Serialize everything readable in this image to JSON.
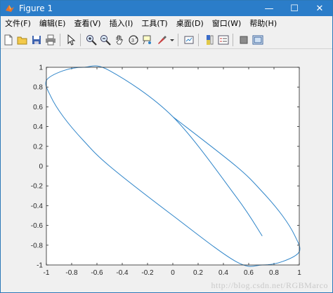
{
  "window": {
    "title": "Figure 1"
  },
  "menu": [
    "文件(F)",
    "编辑(E)",
    "查看(V)",
    "插入(I)",
    "工具(T)",
    "桌面(D)",
    "窗口(W)",
    "帮助(H)"
  ],
  "toolbar": {
    "icons": [
      "new-figure-icon",
      "open-file-icon",
      "save-icon",
      "print-icon",
      "pointer-icon",
      "zoom-in-icon",
      "zoom-out-icon",
      "pan-icon",
      "rotate-3d-icon",
      "data-cursor-icon",
      "brush-icon",
      "link-plot-icon",
      "colorbar-icon",
      "legend-icon",
      "hide-plot-tools-icon",
      "show-plot-tools-icon"
    ]
  },
  "chart_data": {
    "type": "line",
    "title": "",
    "xlabel": "",
    "ylabel": "",
    "xlim": [
      -1,
      1
    ],
    "ylim": [
      -1,
      1
    ],
    "xticks": [
      "-1",
      "-0.8",
      "-0.6",
      "-0.4",
      "-0.2",
      "0",
      "0.2",
      "0.4",
      "0.6",
      "0.8",
      "1"
    ],
    "yticks": [
      "1",
      "0.8",
      "0.6",
      "0.4",
      "0.2",
      "0",
      "-0.2",
      "-0.4",
      "-0.6",
      "-0.8",
      "-1"
    ],
    "series": [
      {
        "color": "#2f85c9",
        "x": [
          0.707,
          0.5,
          0,
          -0.5,
          -0.707,
          -0.866,
          -1,
          -0.966,
          -0.866,
          -0.707,
          -0.5,
          0,
          0.5,
          0.707,
          0.866,
          1,
          0.966,
          0.866,
          0.707,
          0.5,
          0
        ],
        "y": [
          -0.707,
          -0.309,
          0.5,
          0.966,
          1,
          0.966,
          0.866,
          0.707,
          0.5,
          0.259,
          0,
          -0.5,
          -0.966,
          -1,
          -0.966,
          -0.866,
          -0.707,
          -0.5,
          -0.259,
          0,
          0.5
        ]
      }
    ],
    "grid": false,
    "box": true
  },
  "watermark": "http://blog.csdn.net/RGBMarco"
}
